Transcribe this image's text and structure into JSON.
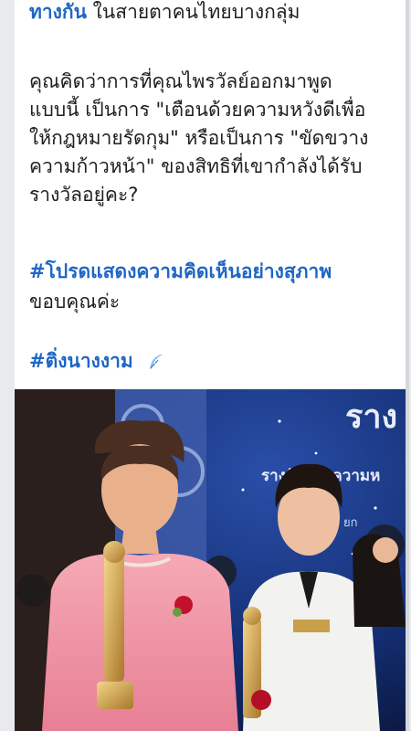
{
  "post": {
    "line1_link": "ทางกัน",
    "line1_rest": " ในสายตาคนไทยบางกลุ่ม",
    "para": [
      "คุณคิดว่าการที่คุณไพรวัลย์ออกมาพูด",
      "แบบนี้ เป็นการ \"เตือนด้วยความหวังดีเพื่อ",
      "ให้กฎหมายรัดกุม\" หรือเป็นการ \"ขัดขวาง",
      "ความก้าวหน้า\" ของสิทธิที่เขากำลังได้รับ",
      "รางวัลอยู่คะ?"
    ],
    "hashtag1": "#โปรดแสดงความคิดเห็นอย่างสุภาพ",
    "thanks": "ขอบคุณค่ะ",
    "hashtag2": "#ติ่งนางงาม",
    "feather_icon": "feather-icon"
  },
  "photo": {
    "banner_title": "รางวัลแห่งความห",
    "banner_big": "ราง",
    "banner_sub": "ยก"
  },
  "colors": {
    "link": "#1f66c4",
    "text": "#1c1e21",
    "background": "#e9eaee"
  }
}
